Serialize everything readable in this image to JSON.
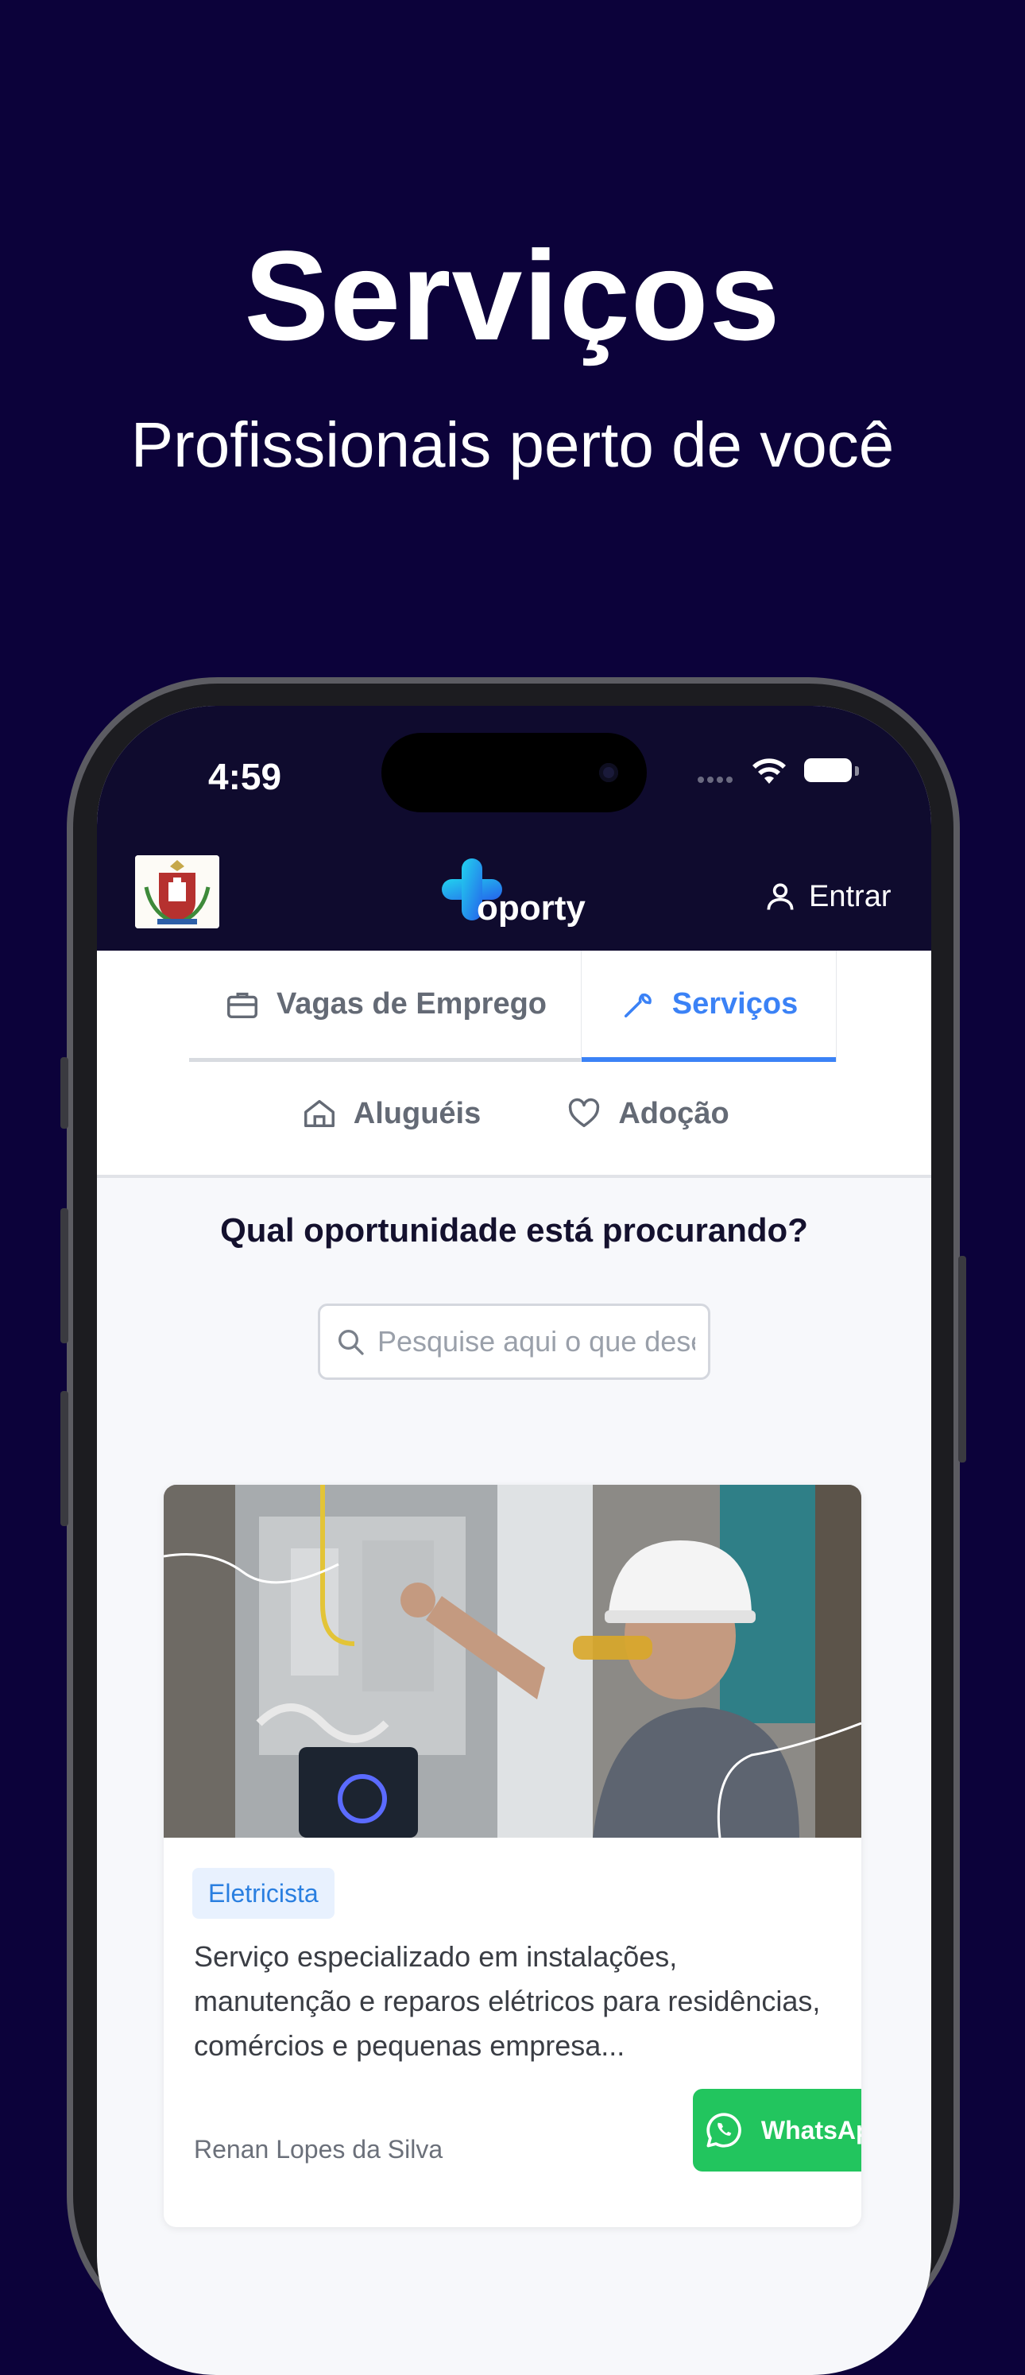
{
  "hero": {
    "title": "Serviços",
    "subtitle": "Profissionais perto de você"
  },
  "status_bar": {
    "time": "4:59"
  },
  "header": {
    "logo_text": "oporty",
    "login_label": "Entrar"
  },
  "tabs": [
    {
      "label": "Vagas de Emprego",
      "icon": "briefcase-icon",
      "active": false
    },
    {
      "label": "Serviços",
      "icon": "wrench-icon",
      "active": true
    },
    {
      "label": "Aluguéis",
      "icon": "home-icon",
      "active": false
    },
    {
      "label": "Adoção",
      "icon": "heart-icon",
      "active": false
    }
  ],
  "main": {
    "question": "Qual oportunidade está procurando?",
    "search_placeholder": "Pesquise aqui o que deseja"
  },
  "card": {
    "category": "Eletricista",
    "description": "Serviço especializado em instalações, manutenção e reparos elétricos para residências, comércios e pequenas empresa...",
    "author": "Renan Lopes da Silva",
    "button_label": "WhatsApp"
  },
  "colors": {
    "background": "#0c023a",
    "topbar": "#0f0b2e",
    "accent": "#3b82f6",
    "whatsapp": "#22c55e"
  }
}
